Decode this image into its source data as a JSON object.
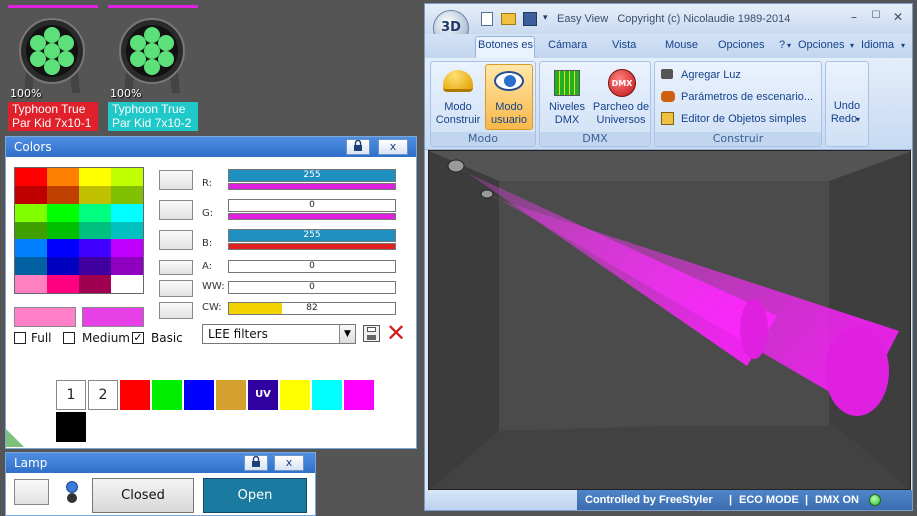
{
  "fixtures": [
    {
      "percent": "100%",
      "name_line1": "Typhoon True",
      "name_line2": "Par Kid 7x10-1",
      "label_color": "#e0202a"
    },
    {
      "percent": "100%",
      "name_line1": "Typhoon True",
      "name_line2": "Par Kid 7x10-2",
      "label_color": "#20c8c8"
    }
  ],
  "colors_panel": {
    "title": "Colors",
    "lock_icon": "lock-icon",
    "close_label": "x",
    "channels": [
      {
        "label": "R:",
        "value": "255",
        "level": 1.0,
        "fill": "#1e8fbf",
        "underbar": "#e020e0"
      },
      {
        "label": "G:",
        "value": "0",
        "level": 0.0,
        "fill": "#1e8fbf",
        "underbar": "#e020e0"
      },
      {
        "label": "B:",
        "value": "255",
        "level": 1.0,
        "fill": "#1e8fbf",
        "underbar": "#e020e0"
      },
      {
        "label": "A:",
        "value": "0",
        "level": 0.0,
        "fill": "#1e8fbf"
      },
      {
        "label": "WW:",
        "value": "0",
        "level": 0.0,
        "fill": "#1e8fbf"
      },
      {
        "label": "CW:",
        "value": "82",
        "level": 0.32,
        "fill": "#f2d200"
      }
    ],
    "checkboxes": [
      {
        "label": "Full",
        "checked": false
      },
      {
        "label": "Medium",
        "checked": false
      },
      {
        "label": "Basic",
        "checked": true
      }
    ],
    "filter_select": "LEE filters",
    "presets": [
      "1",
      "2"
    ],
    "preset_uv": "UV",
    "current_color": "#ff80c8",
    "previous_color": "#e640e6"
  },
  "lamp_panel": {
    "title": "Lamp",
    "close_label": "x",
    "closed_label": "Closed",
    "open_label": "Open"
  },
  "app": {
    "title": "Easy View   Copyright (c) Nicolaudie 1989-2014",
    "logo_text": "3D",
    "tabs": [
      "Botones es",
      "Cámara",
      "Vista",
      "Mouse",
      "Opciones",
      "?",
      "Opciones",
      "Idioma"
    ],
    "groups": {
      "modo": "Modo",
      "dmx": "DMX",
      "construir": "Construir"
    },
    "buttons": {
      "modo_construir": [
        "Modo",
        "Construir"
      ],
      "modo_usuario": [
        "Modo",
        "usuario"
      ],
      "niveles_dmx": [
        "Niveles",
        "DMX"
      ],
      "parcheo_universos": [
        "Parcheo de",
        "Universos"
      ],
      "agregar_luz": "Agregar Luz",
      "parametros": "Parámetros de escenario...",
      "editor_objetos": "Editor de Objetos simples",
      "undo": "Undo",
      "redo": "Redo"
    },
    "status": {
      "controlled_by": "Controlled by FreeStyler",
      "eco_mode": "ECO MODE",
      "dmx_on": "DMX ON"
    }
  }
}
